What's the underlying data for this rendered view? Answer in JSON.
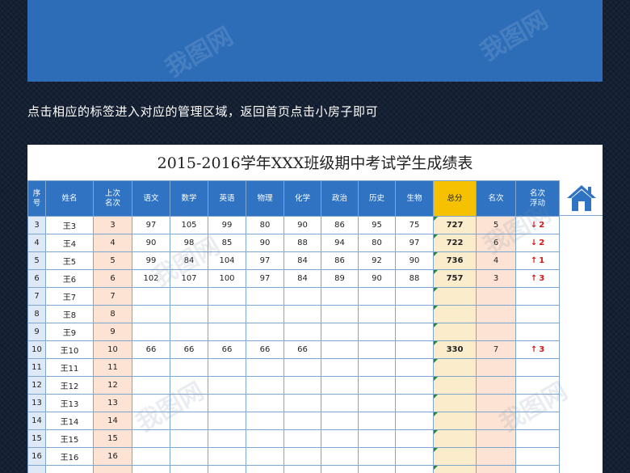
{
  "instruction": "点击相应的标签进入对应的管理区域，返回首页点击小房子即可",
  "sheet": {
    "title": "2015-2016学年XXX班级期中考试学生成绩表",
    "headers": {
      "seq": [
        "序",
        "号"
      ],
      "name": "姓名",
      "prev_rank": [
        "上次",
        "名次"
      ],
      "chinese": "语文",
      "math": "数学",
      "english": "英语",
      "physics": "物理",
      "chemistry": "化学",
      "politics": "政治",
      "history": "历史",
      "biology": "生物",
      "total": "总分",
      "rank": "名次",
      "change": [
        "名次",
        "浮动"
      ]
    },
    "rows": [
      {
        "seq": "3",
        "name": "王3",
        "prev": "3",
        "s1": "97",
        "s2": "105",
        "s3": "99",
        "s4": "80",
        "s5": "90",
        "s6": "86",
        "s7": "95",
        "s8": "75",
        "total": "727",
        "rank": "5",
        "dir": "↓",
        "change": "2"
      },
      {
        "seq": "4",
        "name": "王4",
        "prev": "4",
        "s1": "90",
        "s2": "98",
        "s3": "85",
        "s4": "90",
        "s5": "88",
        "s6": "94",
        "s7": "80",
        "s8": "97",
        "total": "722",
        "rank": "6",
        "dir": "↓",
        "change": "2"
      },
      {
        "seq": "5",
        "name": "王5",
        "prev": "5",
        "s1": "99",
        "s2": "84",
        "s3": "104",
        "s4": "97",
        "s5": "84",
        "s6": "86",
        "s7": "92",
        "s8": "90",
        "total": "736",
        "rank": "4",
        "dir": "↑",
        "change": "1"
      },
      {
        "seq": "6",
        "name": "王6",
        "prev": "6",
        "s1": "102",
        "s2": "107",
        "s3": "100",
        "s4": "97",
        "s5": "84",
        "s6": "89",
        "s7": "90",
        "s8": "88",
        "total": "757",
        "rank": "3",
        "dir": "↑",
        "change": "3"
      },
      {
        "seq": "7",
        "name": "王7",
        "prev": "7",
        "s1": "",
        "s2": "",
        "s3": "",
        "s4": "",
        "s5": "",
        "s6": "",
        "s7": "",
        "s8": "",
        "total": "",
        "rank": "",
        "dir": "",
        "change": ""
      },
      {
        "seq": "8",
        "name": "王8",
        "prev": "8",
        "s1": "",
        "s2": "",
        "s3": "",
        "s4": "",
        "s5": "",
        "s6": "",
        "s7": "",
        "s8": "",
        "total": "",
        "rank": "",
        "dir": "",
        "change": ""
      },
      {
        "seq": "9",
        "name": "王9",
        "prev": "9",
        "s1": "",
        "s2": "",
        "s3": "",
        "s4": "",
        "s5": "",
        "s6": "",
        "s7": "",
        "s8": "",
        "total": "",
        "rank": "",
        "dir": "",
        "change": ""
      },
      {
        "seq": "10",
        "name": "王10",
        "prev": "10",
        "s1": "66",
        "s2": "66",
        "s3": "66",
        "s4": "66",
        "s5": "66",
        "s6": "",
        "s7": "",
        "s8": "",
        "total": "330",
        "rank": "7",
        "dir": "↑",
        "change": "3"
      },
      {
        "seq": "11",
        "name": "王11",
        "prev": "11",
        "s1": "",
        "s2": "",
        "s3": "",
        "s4": "",
        "s5": "",
        "s6": "",
        "s7": "",
        "s8": "",
        "total": "",
        "rank": "",
        "dir": "",
        "change": ""
      },
      {
        "seq": "12",
        "name": "王12",
        "prev": "12",
        "s1": "",
        "s2": "",
        "s3": "",
        "s4": "",
        "s5": "",
        "s6": "",
        "s7": "",
        "s8": "",
        "total": "",
        "rank": "",
        "dir": "",
        "change": ""
      },
      {
        "seq": "13",
        "name": "王13",
        "prev": "13",
        "s1": "",
        "s2": "",
        "s3": "",
        "s4": "",
        "s5": "",
        "s6": "",
        "s7": "",
        "s8": "",
        "total": "",
        "rank": "",
        "dir": "",
        "change": ""
      },
      {
        "seq": "14",
        "name": "王14",
        "prev": "14",
        "s1": "",
        "s2": "",
        "s3": "",
        "s4": "",
        "s5": "",
        "s6": "",
        "s7": "",
        "s8": "",
        "total": "",
        "rank": "",
        "dir": "",
        "change": ""
      },
      {
        "seq": "15",
        "name": "王15",
        "prev": "15",
        "s1": "",
        "s2": "",
        "s3": "",
        "s4": "",
        "s5": "",
        "s6": "",
        "s7": "",
        "s8": "",
        "total": "",
        "rank": "",
        "dir": "",
        "change": ""
      },
      {
        "seq": "16",
        "name": "王16",
        "prev": "16",
        "s1": "",
        "s2": "",
        "s3": "",
        "s4": "",
        "s5": "",
        "s6": "",
        "s7": "",
        "s8": "",
        "total": "",
        "rank": "",
        "dir": "",
        "change": ""
      },
      {
        "seq": "",
        "name": "",
        "prev": "",
        "s1": "",
        "s2": "",
        "s3": "",
        "s4": "",
        "s5": "",
        "s6": "",
        "s7": "",
        "s8": "",
        "total": "",
        "rank": "",
        "dir": "",
        "change": ""
      }
    ]
  },
  "home_icon": "home-icon",
  "watermark": "我图网",
  "colors": {
    "banner": "#2d6db8",
    "header": "#2f73c2",
    "total_header": "#f5c100",
    "up_down": "#d01818"
  }
}
